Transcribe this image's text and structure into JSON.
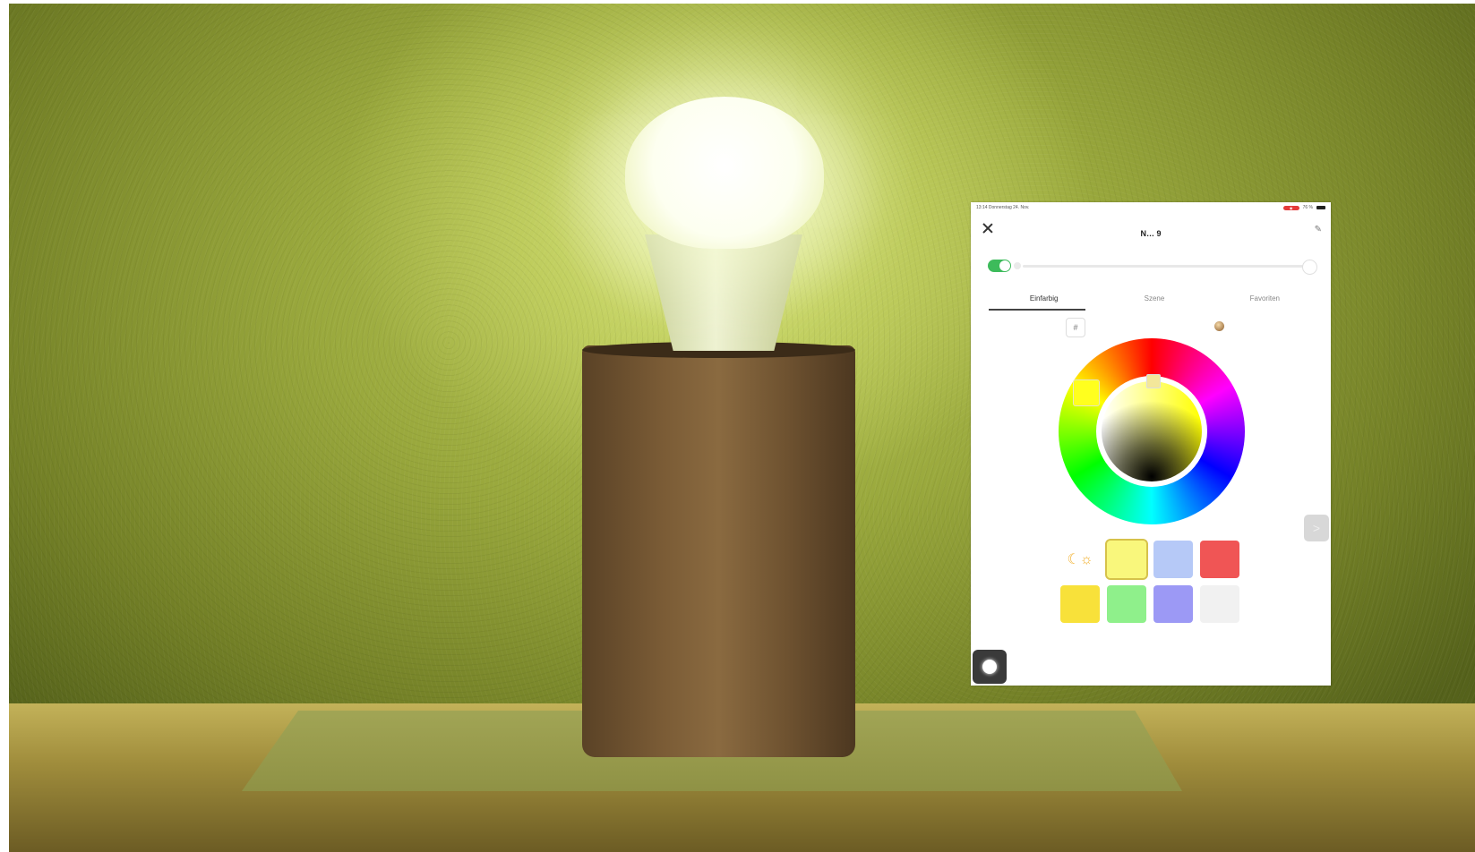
{
  "status_bar": {
    "time_date": "13:14 Donnerstag 24. Nov.",
    "recording": "◉",
    "battery": "76 %"
  },
  "header": {
    "title": "N… 9",
    "close_icon": "close-icon",
    "edit_icon": "edit-icon"
  },
  "power": {
    "on": true
  },
  "brightness": {
    "level": 0.98
  },
  "tabs": [
    {
      "label": "Einfarbig",
      "active": true
    },
    {
      "label": "Szene",
      "active": false
    },
    {
      "label": "Favoriten",
      "active": false
    }
  ],
  "tools": {
    "hex_label": "#",
    "picker_icon": "eyedropper-icon"
  },
  "color_wheel": {
    "selected_color": "#ffff1e"
  },
  "side_arrow": ">",
  "presets": [
    {
      "type": "sun-moon-icon",
      "color": "#ffffff"
    },
    {
      "color": "#f9f77c",
      "active": true
    },
    {
      "color": "#b6c9f7"
    },
    {
      "color": "#f05555"
    },
    {
      "color": "#f8e13a"
    },
    {
      "color": "#8ff08b"
    },
    {
      "color": "#9c99f5"
    },
    {
      "color": "#f1f1f1"
    }
  ]
}
